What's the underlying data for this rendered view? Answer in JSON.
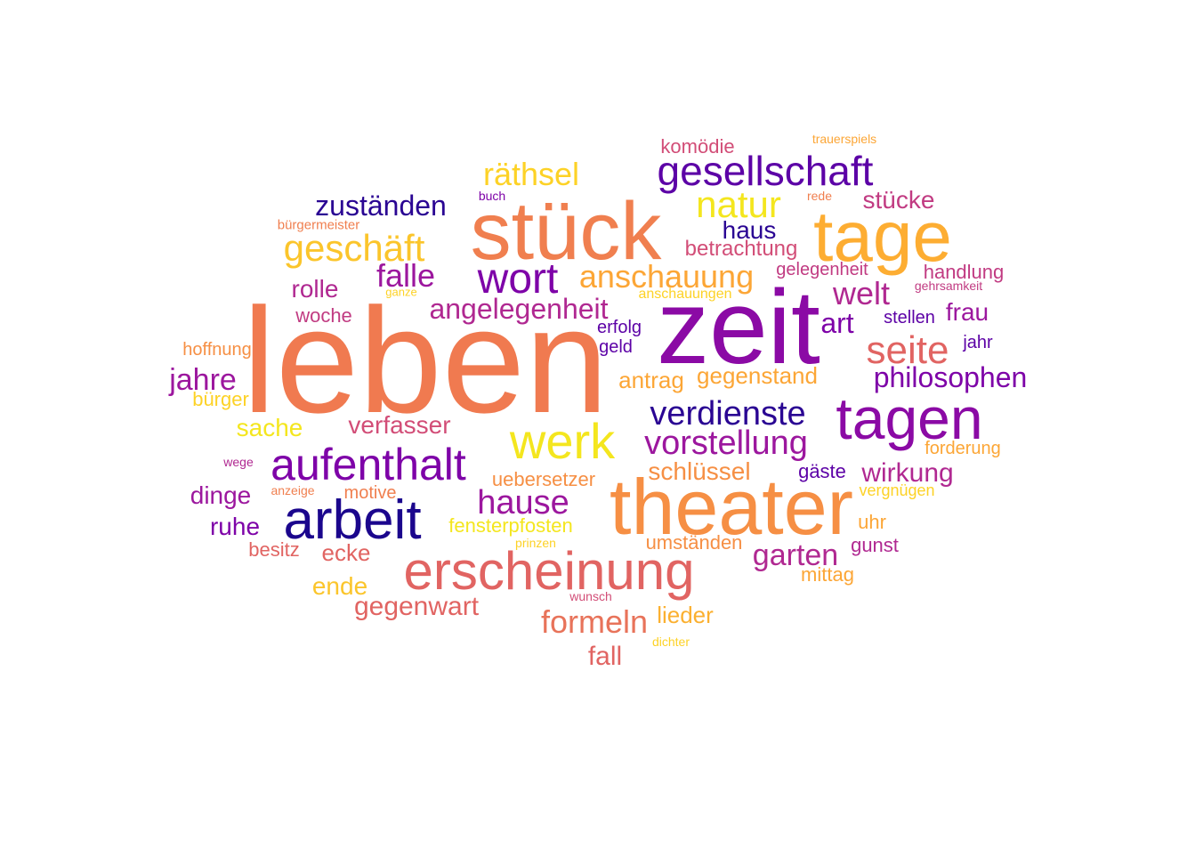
{
  "palette": {
    "c1": "#e8596a",
    "c2": "#6a00a8",
    "c3": "#f0782b",
    "c4": "#8f10a0",
    "c5": "#2a0593",
    "c6": "#fdb42f",
    "c7": "#f6e626",
    "c8": "#b02891",
    "c9": "#d24d77",
    "c10": "#f89540"
  },
  "words": [
    {
      "text": "leben",
      "color": "#f07a50"
    },
    {
      "text": "zeit",
      "color": "#8b0aa5"
    },
    {
      "text": "theater",
      "color": "#f68f44"
    },
    {
      "text": "stück",
      "color": "#f07f4f"
    },
    {
      "text": "tage",
      "color": "#fdad32"
    },
    {
      "text": "tagen",
      "color": "#8b0aa5"
    },
    {
      "text": "erscheinung",
      "color": "#e16462"
    },
    {
      "text": "arbeit",
      "color": "#1b068d"
    },
    {
      "text": "werk",
      "color": "#f4e61e"
    },
    {
      "text": "aufenthalt",
      "color": "#7e03a8"
    },
    {
      "text": "wort",
      "color": "#7e03a8"
    },
    {
      "text": "gesellschaft",
      "color": "#5c01a6"
    },
    {
      "text": "verdienste",
      "color": "#2a0593"
    },
    {
      "text": "vorstellung",
      "color": "#9c179e"
    },
    {
      "text": "seite",
      "color": "#e16462"
    },
    {
      "text": "geschäft",
      "color": "#fbc52b"
    },
    {
      "text": "natur",
      "color": "#f4e61e"
    },
    {
      "text": "hause",
      "color": "#9c179e"
    },
    {
      "text": "räthsel",
      "color": "#fdd226"
    },
    {
      "text": "anschauung",
      "color": "#fca636"
    },
    {
      "text": "philosophen",
      "color": "#7e03a8"
    },
    {
      "text": "angelegenheit",
      "color": "#b02891"
    },
    {
      "text": "zuständen",
      "color": "#2a0593"
    },
    {
      "text": "welt",
      "color": "#b02891"
    },
    {
      "text": "falle",
      "color": "#9c179e"
    },
    {
      "text": "formeln",
      "color": "#e8735a"
    },
    {
      "text": "garten",
      "color": "#b02891"
    },
    {
      "text": "jahre",
      "color": "#9c179e"
    },
    {
      "text": "wirkung",
      "color": "#b02891"
    },
    {
      "text": "schlüssel",
      "color": "#f68f44"
    },
    {
      "text": "gegenwart",
      "color": "#e16462"
    },
    {
      "text": "verfasser",
      "color": "#d24d77"
    },
    {
      "text": "art",
      "color": "#7e03a8"
    },
    {
      "text": "haus",
      "color": "#2a0593"
    },
    {
      "text": "betrachtung",
      "color": "#d24d77"
    },
    {
      "text": "gegenstand",
      "color": "#fca636"
    },
    {
      "text": "antrag",
      "color": "#fca636"
    },
    {
      "text": "frau",
      "color": "#9c179e"
    },
    {
      "text": "stücke",
      "color": "#c13b82"
    },
    {
      "text": "rolle",
      "color": "#b02891"
    },
    {
      "text": "sache",
      "color": "#f4e61e"
    },
    {
      "text": "dinge",
      "color": "#9c179e"
    },
    {
      "text": "ruhe",
      "color": "#7e03a8"
    },
    {
      "text": "ende",
      "color": "#fbc52b"
    },
    {
      "text": "ecke",
      "color": "#e16462"
    },
    {
      "text": "fall",
      "color": "#e16462"
    },
    {
      "text": "lieder",
      "color": "#fbb030"
    },
    {
      "text": "uebersetzer",
      "color": "#f68f44"
    },
    {
      "text": "fensterpfosten",
      "color": "#f4e61e"
    },
    {
      "text": "umständen",
      "color": "#f68f44"
    },
    {
      "text": "handlung",
      "color": "#c13b82"
    },
    {
      "text": "komödie",
      "color": "#d24d77"
    },
    {
      "text": "gelegenheit",
      "color": "#c13b82"
    },
    {
      "text": "woche",
      "color": "#c13b82"
    },
    {
      "text": "hoffnung",
      "color": "#f68f44"
    },
    {
      "text": "besitz",
      "color": "#e16462"
    },
    {
      "text": "gunst",
      "color": "#b02891"
    },
    {
      "text": "mittag",
      "color": "#fca636"
    },
    {
      "text": "uhr",
      "color": "#fca636"
    },
    {
      "text": "gäste",
      "color": "#5c01a6"
    },
    {
      "text": "forderung",
      "color": "#fca636"
    },
    {
      "text": "motive",
      "color": "#f07f4f"
    },
    {
      "text": "bürger",
      "color": "#fdd226"
    },
    {
      "text": "erfolg",
      "color": "#5c01a6"
    },
    {
      "text": "geld",
      "color": "#5c01a6"
    },
    {
      "text": "stellen",
      "color": "#5c01a6"
    },
    {
      "text": "jahr",
      "color": "#5c01a6"
    },
    {
      "text": "vergnügen",
      "color": "#fdd226"
    },
    {
      "text": "anschauungen",
      "color": "#fdd226"
    },
    {
      "text": "bürgermeister",
      "color": "#f07f4f"
    },
    {
      "text": "trauerspiels",
      "color": "#fca636"
    },
    {
      "text": "rede",
      "color": "#f07f4f"
    },
    {
      "text": "gehrsamkeit",
      "color": "#c13b82"
    },
    {
      "text": "buch",
      "color": "#7e03a8"
    },
    {
      "text": "ganze",
      "color": "#fdd226"
    },
    {
      "text": "wege",
      "color": "#b02891"
    },
    {
      "text": "anzeige",
      "color": "#f07f4f"
    },
    {
      "text": "prinzen",
      "color": "#fdd226"
    },
    {
      "text": "wunsch",
      "color": "#d24d77"
    },
    {
      "text": "dichter",
      "color": "#fdd226"
    }
  ]
}
